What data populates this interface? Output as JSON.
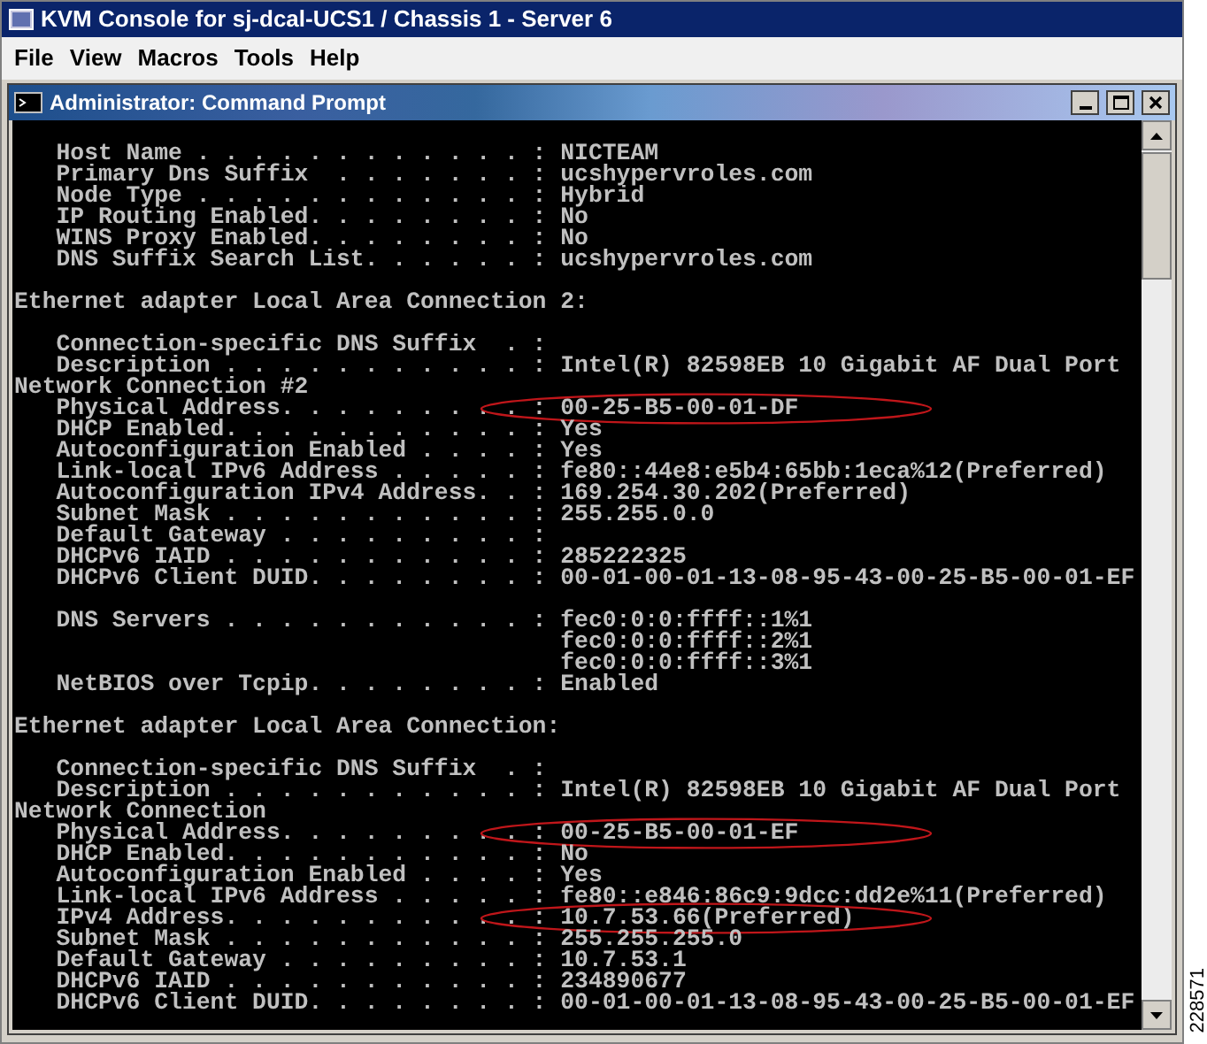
{
  "window": {
    "title": "KVM Console for sj-dcal-UCS1 / Chassis 1 - Server 6"
  },
  "menu": [
    "File",
    "View",
    "Macros",
    "Tools",
    "Help"
  ],
  "inner_window": {
    "title": "Administrator: Command Prompt"
  },
  "console": {
    "blocks": [
      [
        {
          "text": "   Host Name . . . . . . . . . . . . : NICTEAM",
          "circled": false
        },
        {
          "text": "   Primary Dns Suffix  . . . . . . . : ucshypervroles.com",
          "circled": false
        },
        {
          "text": "   Node Type . . . . . . . . . . . . : Hybrid",
          "circled": false
        },
        {
          "text": "   IP Routing Enabled. . . . . . . . : No",
          "circled": false
        },
        {
          "text": "   WINS Proxy Enabled. . . . . . . . : No",
          "circled": false
        },
        {
          "text": "   DNS Suffix Search List. . . . . . : ucshypervroles.com",
          "circled": false
        }
      ],
      [
        {
          "text": "Ethernet adapter Local Area Connection 2:",
          "circled": false
        }
      ],
      [
        {
          "text": "   Connection-specific DNS Suffix  . :",
          "circled": false
        },
        {
          "text": "   Description . . . . . . . . . . . : Intel(R) 82598EB 10 Gigabit AF Dual Port",
          "circled": false
        },
        {
          "text": "Network Connection #2",
          "circled": false
        },
        {
          "text": "   Physical Address. . . . . . . . . : 00-25-B5-00-01-DF",
          "circled": true
        },
        {
          "text": "   DHCP Enabled. . . . . . . . . . . : Yes",
          "circled": false
        },
        {
          "text": "   Autoconfiguration Enabled . . . . : Yes",
          "circled": false
        },
        {
          "text": "   Link-local IPv6 Address . . . . . : fe80::44e8:e5b4:65bb:1eca%12(Preferred)",
          "circled": false
        },
        {
          "text": "   Autoconfiguration IPv4 Address. . : 169.254.30.202(Preferred)",
          "circled": false
        },
        {
          "text": "   Subnet Mask . . . . . . . . . . . : 255.255.0.0",
          "circled": false
        },
        {
          "text": "   Default Gateway . . . . . . . . . :",
          "circled": false
        },
        {
          "text": "   DHCPv6 IAID . . . . . . . . . . . : 285222325",
          "circled": false
        },
        {
          "text": "   DHCPv6 Client DUID. . . . . . . . : 00-01-00-01-13-08-95-43-00-25-B5-00-01-EF",
          "circled": false
        }
      ],
      [
        {
          "text": "   DNS Servers . . . . . . . . . . . : fec0:0:0:ffff::1%1",
          "circled": false
        },
        {
          "text": "                                       fec0:0:0:ffff::2%1",
          "circled": false
        },
        {
          "text": "                                       fec0:0:0:ffff::3%1",
          "circled": false
        },
        {
          "text": "   NetBIOS over Tcpip. . . . . . . . : Enabled",
          "circled": false
        }
      ],
      [
        {
          "text": "Ethernet adapter Local Area Connection:",
          "circled": false
        }
      ],
      [
        {
          "text": "   Connection-specific DNS Suffix  . :",
          "circled": false
        },
        {
          "text": "   Description . . . . . . . . . . . : Intel(R) 82598EB 10 Gigabit AF Dual Port",
          "circled": false
        },
        {
          "text": "Network Connection",
          "circled": false
        },
        {
          "text": "   Physical Address. . . . . . . . . : 00-25-B5-00-01-EF",
          "circled": true
        },
        {
          "text": "   DHCP Enabled. . . . . . . . . . . : No",
          "circled": false
        },
        {
          "text": "   Autoconfiguration Enabled . . . . : Yes",
          "circled": false
        },
        {
          "text": "   Link-local IPv6 Address . . . . . : fe80::e846:86c9:9dcc:dd2e%11(Preferred)",
          "circled": false
        },
        {
          "text": "   IPv4 Address. . . . . . . . . . . : 10.7.53.66(Preferred)",
          "circled": true
        },
        {
          "text": "   Subnet Mask . . . . . . . . . . . : 255.255.255.0",
          "circled": false
        },
        {
          "text": "   Default Gateway . . . . . . . . . : 10.7.53.1",
          "circled": false
        },
        {
          "text": "   DHCPv6 IAID . . . . . . . . . . . : 234890677",
          "circled": false
        },
        {
          "text": "   DHCPv6 Client DUID. . . . . . . . : 00-01-00-01-13-08-95-43-00-25-B5-00-01-EF",
          "circled": false
        }
      ]
    ]
  },
  "figure_number": "228571"
}
